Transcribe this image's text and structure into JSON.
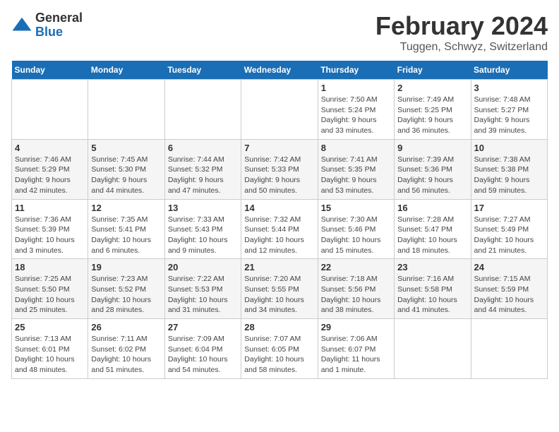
{
  "logo": {
    "general": "General",
    "blue": "Blue"
  },
  "header": {
    "title": "February 2024",
    "subtitle": "Tuggen, Schwyz, Switzerland"
  },
  "calendar": {
    "days_of_week": [
      "Sunday",
      "Monday",
      "Tuesday",
      "Wednesday",
      "Thursday",
      "Friday",
      "Saturday"
    ],
    "weeks": [
      [
        {
          "day": "",
          "info": ""
        },
        {
          "day": "",
          "info": ""
        },
        {
          "day": "",
          "info": ""
        },
        {
          "day": "",
          "info": ""
        },
        {
          "day": "1",
          "info": "Sunrise: 7:50 AM\nSunset: 5:24 PM\nDaylight: 9 hours\nand 33 minutes."
        },
        {
          "day": "2",
          "info": "Sunrise: 7:49 AM\nSunset: 5:25 PM\nDaylight: 9 hours\nand 36 minutes."
        },
        {
          "day": "3",
          "info": "Sunrise: 7:48 AM\nSunset: 5:27 PM\nDaylight: 9 hours\nand 39 minutes."
        }
      ],
      [
        {
          "day": "4",
          "info": "Sunrise: 7:46 AM\nSunset: 5:29 PM\nDaylight: 9 hours\nand 42 minutes."
        },
        {
          "day": "5",
          "info": "Sunrise: 7:45 AM\nSunset: 5:30 PM\nDaylight: 9 hours\nand 44 minutes."
        },
        {
          "day": "6",
          "info": "Sunrise: 7:44 AM\nSunset: 5:32 PM\nDaylight: 9 hours\nand 47 minutes."
        },
        {
          "day": "7",
          "info": "Sunrise: 7:42 AM\nSunset: 5:33 PM\nDaylight: 9 hours\nand 50 minutes."
        },
        {
          "day": "8",
          "info": "Sunrise: 7:41 AM\nSunset: 5:35 PM\nDaylight: 9 hours\nand 53 minutes."
        },
        {
          "day": "9",
          "info": "Sunrise: 7:39 AM\nSunset: 5:36 PM\nDaylight: 9 hours\nand 56 minutes."
        },
        {
          "day": "10",
          "info": "Sunrise: 7:38 AM\nSunset: 5:38 PM\nDaylight: 9 hours\nand 59 minutes."
        }
      ],
      [
        {
          "day": "11",
          "info": "Sunrise: 7:36 AM\nSunset: 5:39 PM\nDaylight: 10 hours\nand 3 minutes."
        },
        {
          "day": "12",
          "info": "Sunrise: 7:35 AM\nSunset: 5:41 PM\nDaylight: 10 hours\nand 6 minutes."
        },
        {
          "day": "13",
          "info": "Sunrise: 7:33 AM\nSunset: 5:43 PM\nDaylight: 10 hours\nand 9 minutes."
        },
        {
          "day": "14",
          "info": "Sunrise: 7:32 AM\nSunset: 5:44 PM\nDaylight: 10 hours\nand 12 minutes."
        },
        {
          "day": "15",
          "info": "Sunrise: 7:30 AM\nSunset: 5:46 PM\nDaylight: 10 hours\nand 15 minutes."
        },
        {
          "day": "16",
          "info": "Sunrise: 7:28 AM\nSunset: 5:47 PM\nDaylight: 10 hours\nand 18 minutes."
        },
        {
          "day": "17",
          "info": "Sunrise: 7:27 AM\nSunset: 5:49 PM\nDaylight: 10 hours\nand 21 minutes."
        }
      ],
      [
        {
          "day": "18",
          "info": "Sunrise: 7:25 AM\nSunset: 5:50 PM\nDaylight: 10 hours\nand 25 minutes."
        },
        {
          "day": "19",
          "info": "Sunrise: 7:23 AM\nSunset: 5:52 PM\nDaylight: 10 hours\nand 28 minutes."
        },
        {
          "day": "20",
          "info": "Sunrise: 7:22 AM\nSunset: 5:53 PM\nDaylight: 10 hours\nand 31 minutes."
        },
        {
          "day": "21",
          "info": "Sunrise: 7:20 AM\nSunset: 5:55 PM\nDaylight: 10 hours\nand 34 minutes."
        },
        {
          "day": "22",
          "info": "Sunrise: 7:18 AM\nSunset: 5:56 PM\nDaylight: 10 hours\nand 38 minutes."
        },
        {
          "day": "23",
          "info": "Sunrise: 7:16 AM\nSunset: 5:58 PM\nDaylight: 10 hours\nand 41 minutes."
        },
        {
          "day": "24",
          "info": "Sunrise: 7:15 AM\nSunset: 5:59 PM\nDaylight: 10 hours\nand 44 minutes."
        }
      ],
      [
        {
          "day": "25",
          "info": "Sunrise: 7:13 AM\nSunset: 6:01 PM\nDaylight: 10 hours\nand 48 minutes."
        },
        {
          "day": "26",
          "info": "Sunrise: 7:11 AM\nSunset: 6:02 PM\nDaylight: 10 hours\nand 51 minutes."
        },
        {
          "day": "27",
          "info": "Sunrise: 7:09 AM\nSunset: 6:04 PM\nDaylight: 10 hours\nand 54 minutes."
        },
        {
          "day": "28",
          "info": "Sunrise: 7:07 AM\nSunset: 6:05 PM\nDaylight: 10 hours\nand 58 minutes."
        },
        {
          "day": "29",
          "info": "Sunrise: 7:06 AM\nSunset: 6:07 PM\nDaylight: 11 hours\nand 1 minute."
        },
        {
          "day": "",
          "info": ""
        },
        {
          "day": "",
          "info": ""
        }
      ]
    ]
  }
}
